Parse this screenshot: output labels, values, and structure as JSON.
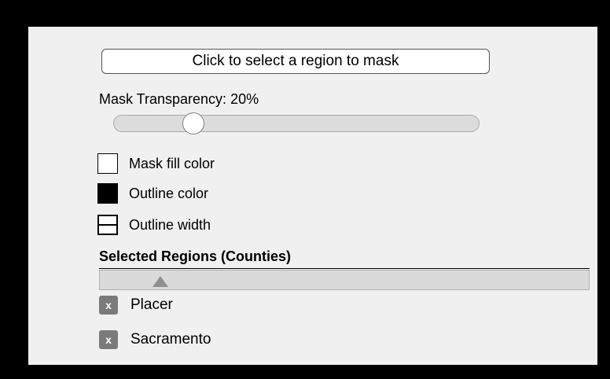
{
  "mask_button": {
    "label": "Click to select a region to mask"
  },
  "transparency": {
    "label": "Mask Transparency: 20%",
    "value_percent": 20
  },
  "options": {
    "fill_color_label": "Mask fill color",
    "outline_color_label": "Outline color",
    "outline_width_label": "Outline width",
    "fill_color": "#ffffff",
    "outline_color": "#000000"
  },
  "regions": {
    "header": "Selected Regions (Counties)",
    "remove_label": "x",
    "items": [
      {
        "name": "Placer"
      },
      {
        "name": "Sacramento"
      }
    ]
  },
  "colors": {
    "page_background": "#000000",
    "panel_background": "#f0f0f0",
    "slider_track": "#dcdcdc",
    "remove_button": "#7a7a7a"
  }
}
